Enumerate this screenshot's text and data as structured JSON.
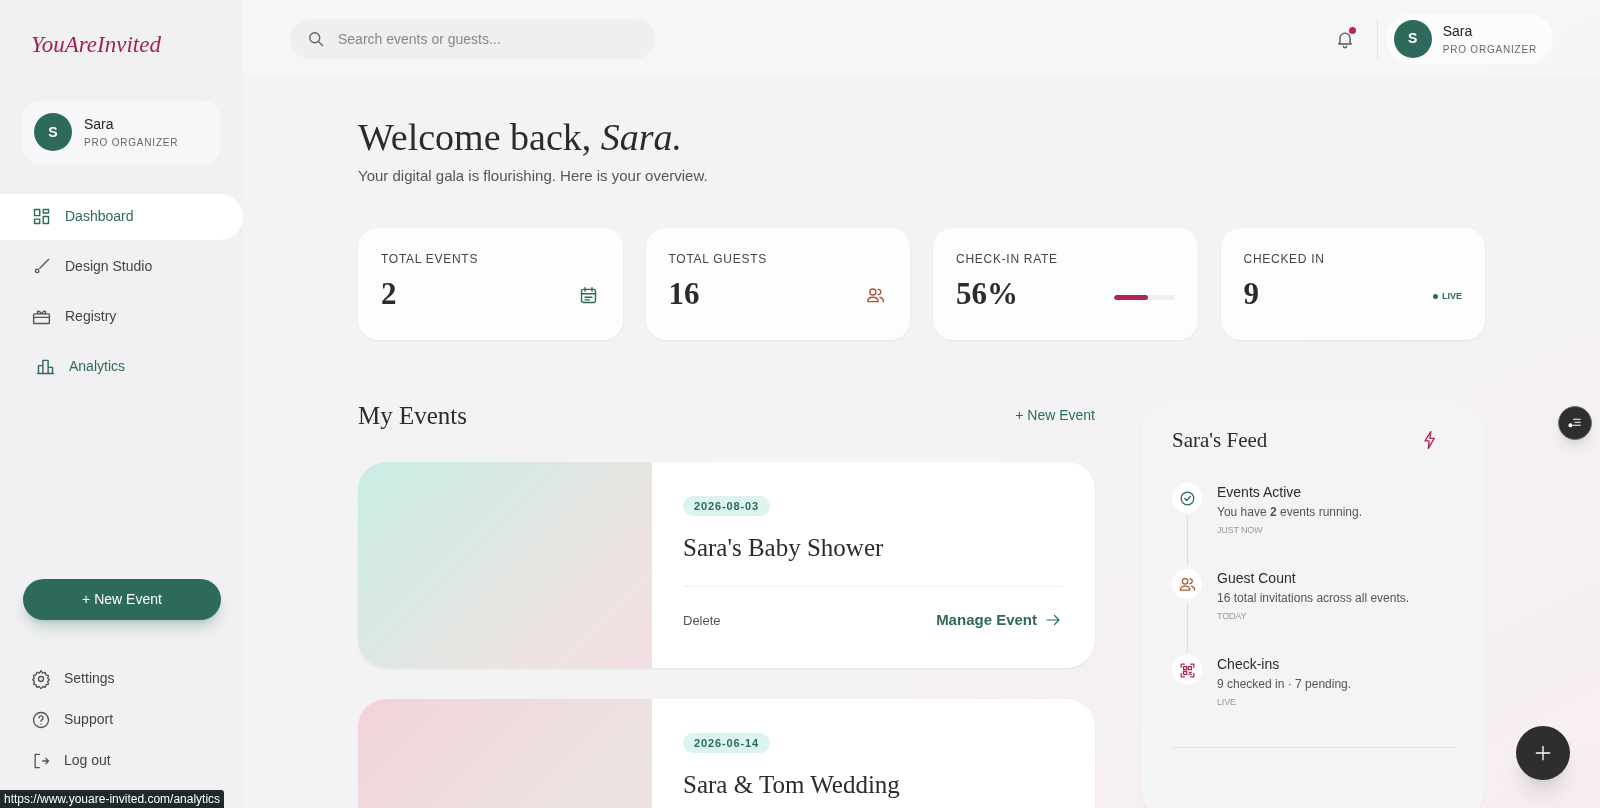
{
  "brand": {
    "logo": "YouAreInvited"
  },
  "sidebar": {
    "profile": {
      "initial": "S",
      "name": "Sara",
      "role": "PRO ORGANIZER"
    },
    "nav": [
      {
        "label": "Dashboard",
        "selected": true,
        "highlighted": false
      },
      {
        "label": "Design Studio",
        "selected": false,
        "highlighted": false
      },
      {
        "label": "Registry",
        "selected": false,
        "highlighted": false
      },
      {
        "label": "Analytics",
        "selected": false,
        "highlighted": true
      }
    ],
    "new_event_button": "+ New Event",
    "footer_links": [
      "Settings",
      "Support",
      "Log out"
    ]
  },
  "header": {
    "search": {
      "placeholder": "Search events or guests..."
    },
    "notifications": {
      "unread": true
    },
    "profile": {
      "initial": "S",
      "name": "Sara",
      "role": "PRO ORGANIZER"
    }
  },
  "welcome": {
    "title": "Welcome back, *Sara.*",
    "subtitle": "Your digital gala is flourishing. Here is your overview."
  },
  "stats": [
    {
      "kind": "icon",
      "label": "TOTAL EVENTS",
      "value": "2"
    },
    {
      "kind": "icon",
      "label": "TOTAL GUESTS",
      "value": "16"
    },
    {
      "kind": "meter",
      "label": "CHECK-IN RATE",
      "value": "56%",
      "level": 0.56
    },
    {
      "kind": "live",
      "label": "CHECKED IN",
      "value": "9",
      "badge": "LIVE"
    }
  ],
  "events_section": {
    "title": "My Events",
    "new_event_link": "+ New Event",
    "events": [
      {
        "date": "2026-08-03",
        "title": "Sara's Baby Shower",
        "color": "#c9ede4",
        "delete": "Delete",
        "manage": "Manage Event"
      },
      {
        "date": "2026-06-14",
        "title": "Sara & Tom Wedding",
        "color": "#f1d3da"
      }
    ]
  },
  "feed": {
    "title": "Sara's Feed",
    "items": [
      {
        "title": "Events Active",
        "text": "You have **2** events running.",
        "time": "JUST NOW"
      },
      {
        "title": "Guest Count",
        "text": "16 total invitations across all events.",
        "time": "TODAY"
      },
      {
        "title": "Check-ins",
        "text": "9 checked in · 7 pending.",
        "time": "LIVE"
      }
    ]
  },
  "status_bar": {
    "url": "https://www.youare-invited.com/analytics"
  }
}
